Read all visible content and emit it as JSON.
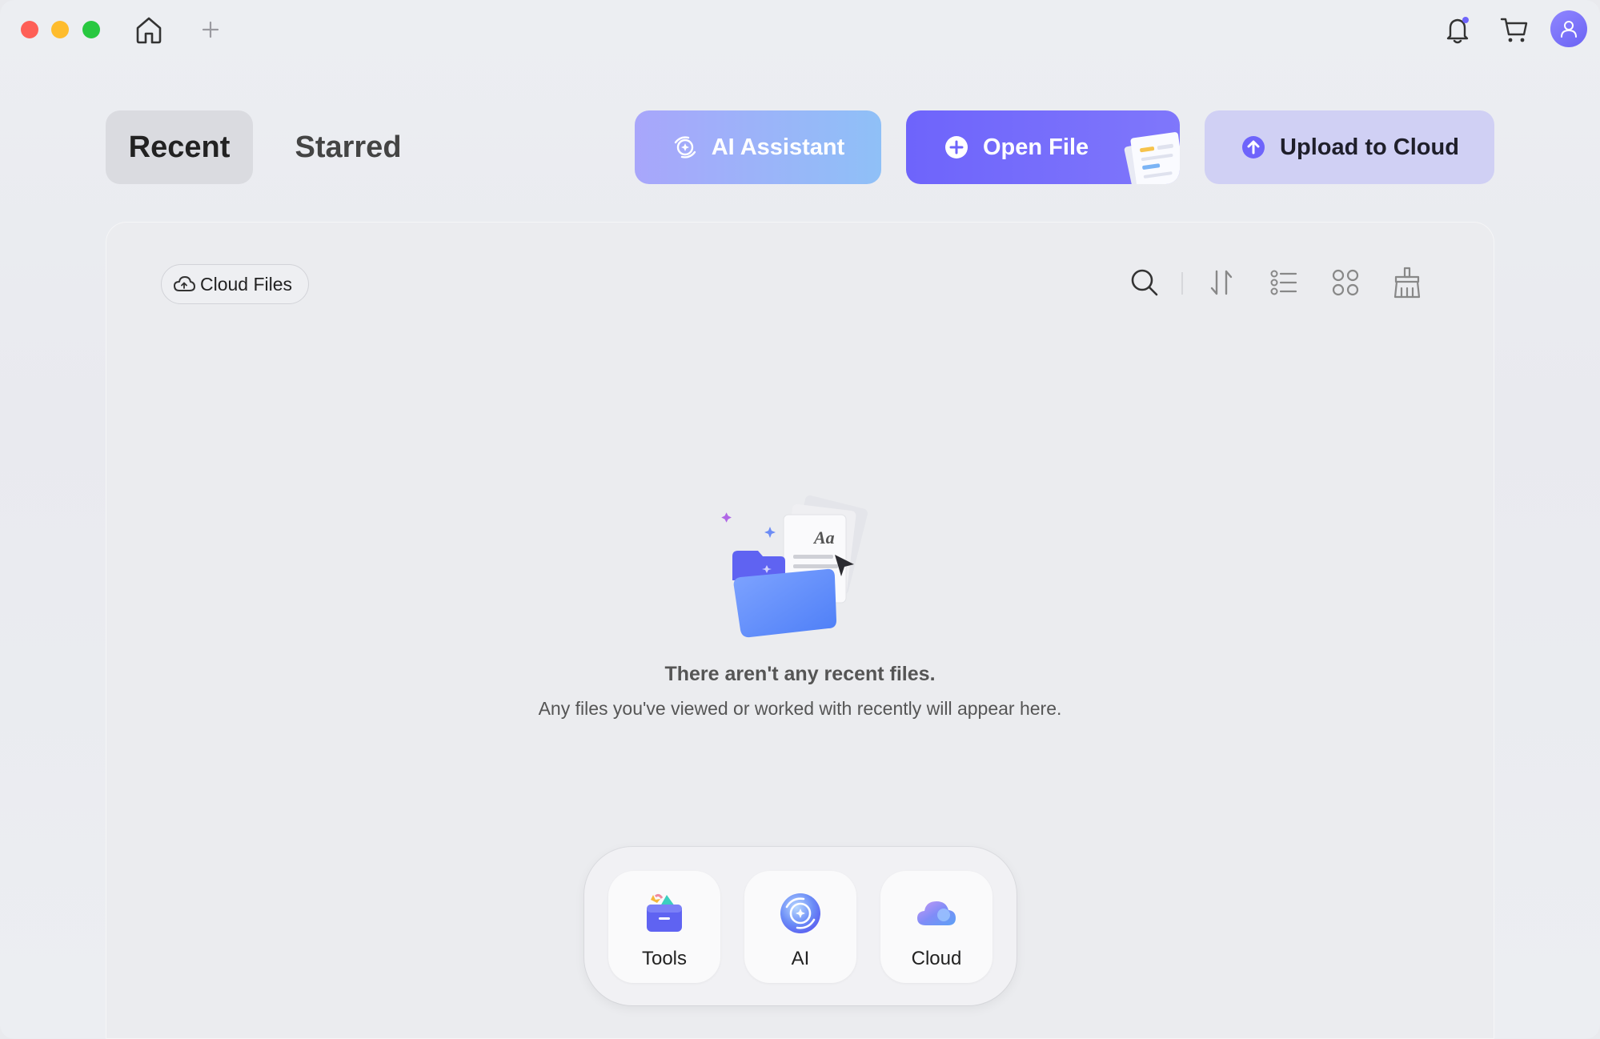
{
  "titlebar": {
    "icons": [
      "home-icon",
      "plus-icon",
      "bell-icon",
      "cart-icon",
      "user-icon"
    ]
  },
  "tabs": [
    {
      "label": "Recent",
      "selected": true
    },
    {
      "label": "Starred",
      "selected": false
    }
  ],
  "actions": {
    "ai_assistant": "AI Assistant",
    "open_file": "Open File",
    "upload": "Upload to Cloud"
  },
  "panel": {
    "cloud_files": "Cloud Files",
    "toolbar_icons": [
      "search-icon",
      "sort-icon",
      "list-view-icon",
      "grid-view-icon",
      "clean-icon"
    ]
  },
  "empty_state": {
    "title": "There aren't any recent files.",
    "subtitle": "Any files you've viewed or worked with recently will appear here."
  },
  "dock": [
    {
      "label": "Tools",
      "icon": "tools-icon"
    },
    {
      "label": "AI",
      "icon": "ai-icon"
    },
    {
      "label": "Cloud",
      "icon": "cloud-icon"
    }
  ],
  "colors": {
    "accent": "#6e64fb",
    "ai_gradient_start": "#a8a6fb",
    "ai_gradient_end": "#8fc0f7",
    "upload_bg": "#d0d0f4",
    "avatar": "#7a72f8"
  }
}
